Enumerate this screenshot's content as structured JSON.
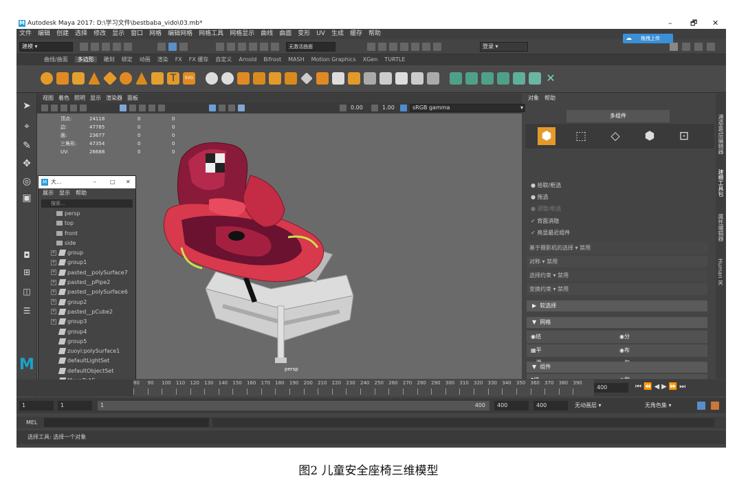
{
  "window": {
    "title": "Autodesk Maya 2017: D:\\学习文件\\bestbaba_vido\\03.mb*",
    "controls": [
      "–",
      "🗗",
      "✕"
    ]
  },
  "menubar": [
    "文件",
    "编辑",
    "创建",
    "选择",
    "修改",
    "显示",
    "窗口",
    "网格",
    "编辑网格",
    "网格工具",
    "网格显示",
    "曲线",
    "曲面",
    "变形",
    "UV",
    "生成",
    "缓存",
    "帮助"
  ],
  "cloud_button": "拖拽上传",
  "status": {
    "mode": "建模",
    "live_field": "无激活曲面",
    "login": "登录"
  },
  "shelf_tabs": [
    "曲线/曲面",
    "多边形",
    "雕刻",
    "绑定",
    "动画",
    "渲染",
    "FX",
    "FX 缓存",
    "自定义",
    "Arnold",
    "Bifrost",
    "MASH",
    "Motion Graphics",
    "XGen",
    "TURTLE"
  ],
  "shelf_active": "多边形",
  "panel_menu": [
    "视图",
    "着色",
    "照明",
    "显示",
    "渲染器",
    "面板"
  ],
  "panel_toolbar": {
    "value1": "0.00",
    "value2": "1.00",
    "color_space": "sRGB gamma"
  },
  "hud": [
    {
      "label": "顶点:",
      "v1": "24118",
      "v2": "0",
      "v3": "0"
    },
    {
      "label": "边:",
      "v1": "47785",
      "v2": "0",
      "v3": "0"
    },
    {
      "label": "面:",
      "v1": "23677",
      "v2": "0",
      "v3": "0"
    },
    {
      "label": "三角形:",
      "v1": "47354",
      "v2": "0",
      "v3": "0"
    },
    {
      "label": "UV:",
      "v1": "26688",
      "v2": "0",
      "v3": "0"
    }
  ],
  "camera_label": "persp",
  "outliner": {
    "title": "大...",
    "menu": [
      "展示",
      "显示",
      "帮助"
    ],
    "search_placeholder": "搜索...",
    "items": [
      {
        "label": "persp",
        "kind": "camera",
        "expander": false
      },
      {
        "label": "top",
        "kind": "camera",
        "expander": false
      },
      {
        "label": "front",
        "kind": "camera",
        "expander": false
      },
      {
        "label": "side",
        "kind": "camera",
        "expander": false
      },
      {
        "label": "group",
        "kind": "group",
        "expander": true
      },
      {
        "label": "group1",
        "kind": "group",
        "expander": true
      },
      {
        "label": "pasted__polySurface7",
        "kind": "group",
        "expander": true
      },
      {
        "label": "pasted__pPipe2",
        "kind": "group",
        "expander": true
      },
      {
        "label": "pasted__polySurface6",
        "kind": "group",
        "expander": true
      },
      {
        "label": "group2",
        "kind": "group",
        "expander": true
      },
      {
        "label": "pasted__pCube2",
        "kind": "group",
        "expander": true
      },
      {
        "label": "group3",
        "kind": "group",
        "expander": true
      },
      {
        "label": "group4",
        "kind": "group",
        "expander": false
      },
      {
        "label": "group5",
        "kind": "group",
        "expander": false
      },
      {
        "label": "zuoyi:polySurface1",
        "kind": "mesh",
        "expander": false
      },
      {
        "label": "defaultLightSet",
        "kind": "set",
        "expander": false
      },
      {
        "label": "defaultObjectSet",
        "kind": "set",
        "expander": false
      },
      {
        "label": "MayaToAE",
        "kind": "set",
        "expander": false
      }
    ]
  },
  "attr": {
    "menu": [
      "对象",
      "帮助"
    ],
    "tab": "多组件",
    "radio": [
      {
        "label": "拾取/框选",
        "dim": false
      },
      {
        "label": "拖选",
        "dim": false
      },
      {
        "label": "调整/框选",
        "dim": true
      }
    ],
    "checks": [
      "背面消隐",
      "亮显最近组件"
    ],
    "lines": [
      "基于摄影机的选择 ▾ 禁用",
      "对称 ▾ 禁用",
      "选择约束 ▾ 禁用",
      "变换约束 ▾ 禁用"
    ],
    "soft": "软选择",
    "mesh_section": "网格",
    "mesh_ops": [
      "结合",
      "分离",
      "平滑",
      "布尔"
    ],
    "component_section": "组件",
    "component_ops": [
      "挤出",
      "倒角"
    ]
  },
  "vtabs": [
    "通道盒/层编辑器",
    "建模工具包",
    "属性编辑器",
    "Human IK"
  ],
  "timeline": {
    "ticks": [
      "80",
      "90",
      "100",
      "110",
      "120",
      "130",
      "140",
      "150",
      "160",
      "170",
      "180",
      "190",
      "200",
      "210",
      "220",
      "230",
      "240",
      "250",
      "260",
      "270",
      "280",
      "290",
      "300",
      "310",
      "320",
      "330",
      "340",
      "350",
      "360",
      "370",
      "380",
      "390"
    ],
    "current": "400",
    "end": "400"
  },
  "range": {
    "start": "1",
    "start2": "1",
    "slider_start": "1",
    "slider_end": "400",
    "end1": "400",
    "end2": "400",
    "anim_layer": "无动画层",
    "char_set": "无角色集"
  },
  "mel_label": "MEL",
  "help_line": "选择工具: 选择一个对象",
  "caption": "图2 儿童安全座椅三维模型"
}
